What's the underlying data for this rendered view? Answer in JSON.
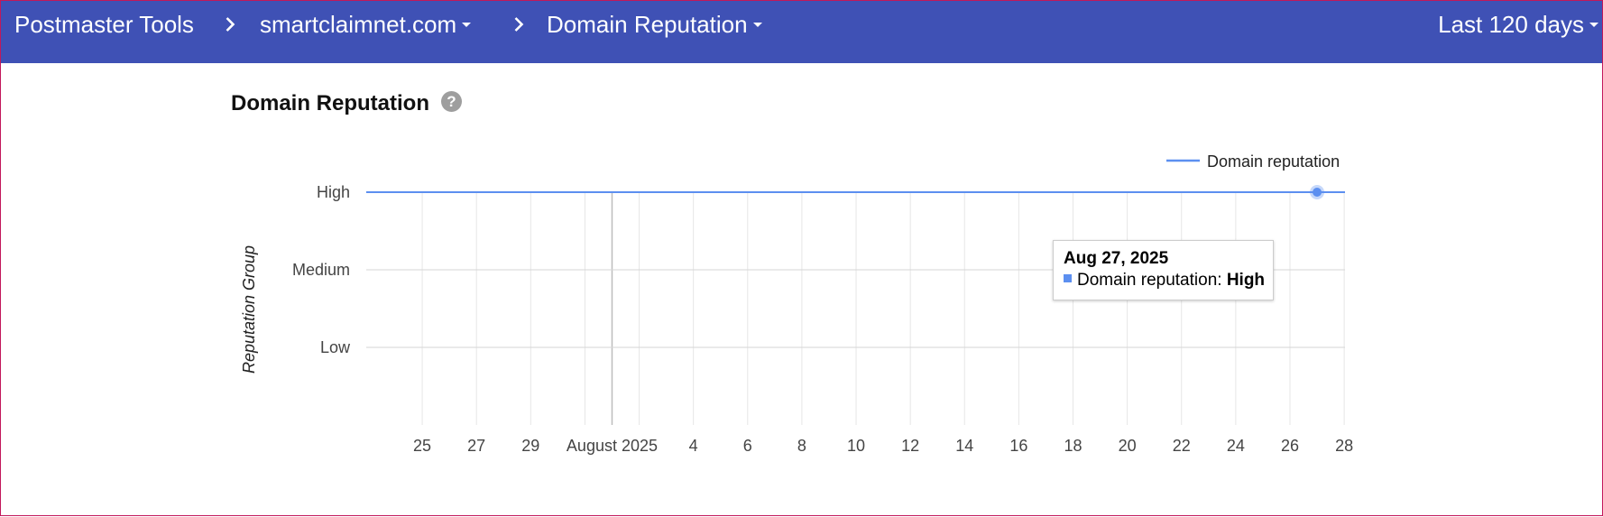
{
  "header": {
    "app_title": "Postmaster Tools",
    "domain": "smartclaimnet.com",
    "section": "Domain Reputation",
    "range": "Last 120 days"
  },
  "page": {
    "title": "Domain Reputation",
    "help_glyph": "?"
  },
  "tooltip": {
    "date": "Aug 27, 2025",
    "series": "Domain reputation:",
    "value": "High"
  },
  "colors": {
    "header_bg": "#3f51b5",
    "series": "#5c8ff0"
  },
  "chart_data": {
    "type": "line",
    "title": "",
    "xlabel": "",
    "ylabel": "Reputation Group",
    "y_categories": [
      "Low",
      "Medium",
      "High"
    ],
    "x_tick_labels": [
      "25",
      "27",
      "29",
      "August 2025",
      "4",
      "6",
      "8",
      "10",
      "12",
      "14",
      "16",
      "18",
      "20",
      "22",
      "24",
      "26",
      "28"
    ],
    "x_range": [
      "2025-07-24",
      "2025-08-29"
    ],
    "grid": true,
    "legend": "top-right",
    "series": [
      {
        "name": "Domain reputation",
        "x": [
          "2025-07-24",
          "2025-08-29"
        ],
        "values": [
          "High",
          "High"
        ],
        "highlighted_point": {
          "x": "2025-08-27",
          "value": "High"
        }
      }
    ]
  }
}
